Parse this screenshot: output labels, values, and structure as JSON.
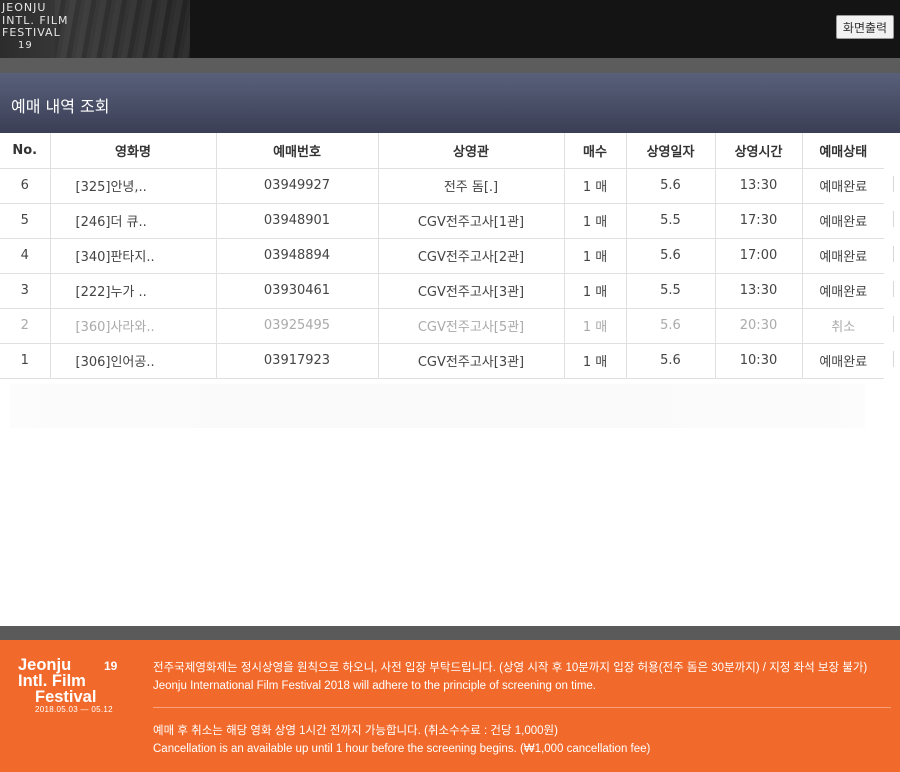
{
  "header": {
    "logo_lines": [
      "JEONJU",
      "INTL. FILM",
      "FESTIVAL"
    ],
    "logo_number": "19",
    "print_label": "화면출력"
  },
  "title": "예매 내역 조회",
  "table": {
    "columns": [
      "No.",
      "영화명",
      "예매번호",
      "상영관",
      "매수",
      "상영일자",
      "상영시간",
      "예매상태"
    ],
    "rows": [
      {
        "no": "6",
        "film": "[325]안녕,..",
        "booking": "03949927",
        "venue": "전주 돔[.]",
        "count": "1 매",
        "date": "5.6",
        "time": "13:30",
        "status": "예매완료"
      },
      {
        "no": "5",
        "film": "[246]더 큐..",
        "booking": "03948901",
        "venue": "CGV전주고사[1관]",
        "count": "1 매",
        "date": "5.5",
        "time": "17:30",
        "status": "예매완료"
      },
      {
        "no": "4",
        "film": "[340]판타지..",
        "booking": "03948894",
        "venue": "CGV전주고사[2관]",
        "count": "1 매",
        "date": "5.6",
        "time": "17:00",
        "status": "예매완료"
      },
      {
        "no": "3",
        "film": "[222]누가 ..",
        "booking": "03930461",
        "venue": "CGV전주고사[3관]",
        "count": "1 매",
        "date": "5.5",
        "time": "13:30",
        "status": "예매완료"
      },
      {
        "no": "2",
        "film": "[360]사라와..",
        "booking": "03925495",
        "venue": "CGV전주고사[5관]",
        "count": "1 매",
        "date": "5.6",
        "time": "20:30",
        "status": "취소"
      },
      {
        "no": "1",
        "film": "[306]인어공..",
        "booking": "03917923",
        "venue": "CGV전주고사[3관]",
        "count": "1 매",
        "date": "5.6",
        "time": "10:30",
        "status": "예매완료"
      }
    ]
  },
  "footer": {
    "logo_lines": [
      "Jeonju",
      "Intl. Film",
      "Festival"
    ],
    "logo_number": "19",
    "dates": "2018.05.03 — 05.12",
    "notice_ko_1": "전주국제영화제는 정시상영을 원칙으로 하오니, 사전 입장 부탁드립니다. (상영 시작 후 10분까지 입장 허용(전주 돔은 30분까지) / 지정 좌석 보장 불가)",
    "notice_en_1": "Jeonju International Film Festival 2018 will adhere to the principle of screening on time.",
    "notice_ko_2": "예매 후 취소는 해당 영화 상영 1시간 전까지 가능합니다. (취소수수료 : 건당 1,000원)",
    "notice_en_2": "Cancellation is an available up until 1 hour before the screening begins. (₩1,000 cancellation fee)"
  },
  "colors": {
    "footer_bg": "#f26a2b",
    "titlebar_bg": "#4a506a",
    "cancelled_text": "#aaaaaa"
  }
}
